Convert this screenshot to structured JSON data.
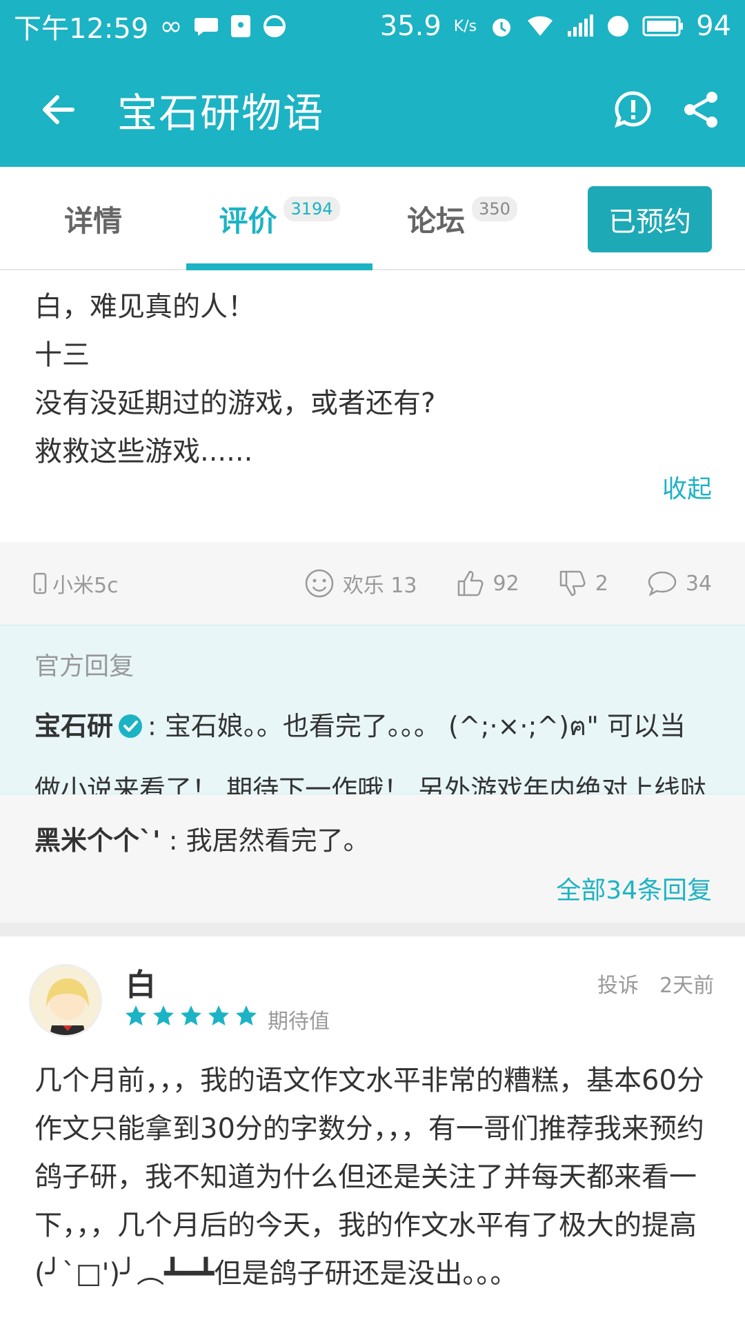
{
  "status_bar": {
    "time": "下午12:59",
    "speed": "35.9",
    "speed_unit": "K/s",
    "battery": "94"
  },
  "app_bar": {
    "title": "宝石研物语",
    "icons": [
      "back-arrow-icon",
      "report-icon",
      "share-icon"
    ]
  },
  "tabs": [
    {
      "label": "详情",
      "badge": ""
    },
    {
      "label": "评价",
      "badge": "3194"
    },
    {
      "label": "论坛",
      "badge": "350"
    }
  ],
  "reserve_button": "已预约",
  "review": {
    "lines": [
      "白，难见真的人！",
      "十三",
      "没有没延期过的游戏，或者还有?",
      "救救这些游戏......"
    ],
    "collapse": "收起"
  },
  "meta": {
    "device": "小米5c",
    "mood": "欢乐 13",
    "likes": "92",
    "dislikes": "2",
    "comments": "34"
  },
  "official_reply": {
    "label": "官方回复",
    "author": "宝石研",
    "text": ": 宝石娘。。也看完了。。。 (^;·×·;^)ฅ\" 可以当做小说来看了！ 期待下一作哦！ 另外游戏年内绝对上线哒"
  },
  "other_reply": {
    "author": "黑米个个`'",
    "text": " : 我居然看完了。"
  },
  "all_replies": "全部34条回复",
  "next_review": {
    "username": "白",
    "rating": 5,
    "rating_label": "期待值",
    "report": "投诉",
    "time": "2天前",
    "text": "几个月前，，，我的语文作文水平非常的糟糕，基本60分作文只能拿到30分的字数分，，，有一哥们推荐我来预约鸽子研，我不知道为什么但还是关注了并每天都来看一下，，，几个月后的今天，我的作文水平有了极大的提高(╯`□')╯︵┻━┻但是鸽子研还是没出。。。"
  },
  "colors": {
    "accent": "#1cb3c4",
    "button": "#1ea9b6",
    "official_bg": "#e8f6f8"
  }
}
